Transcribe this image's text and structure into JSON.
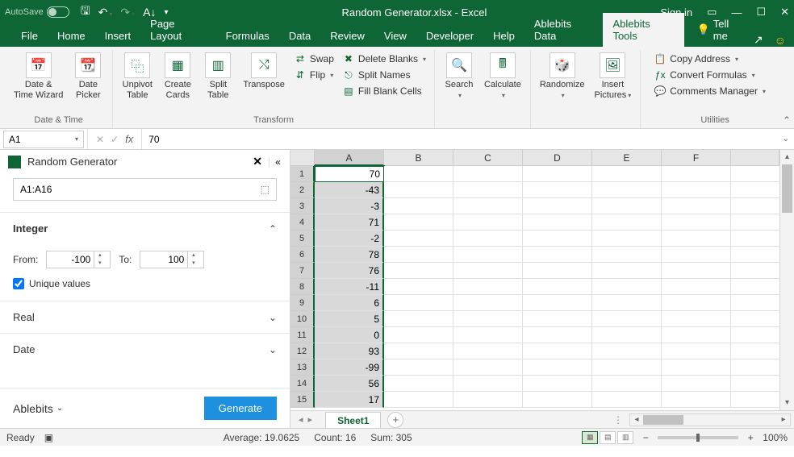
{
  "title_bar": {
    "autosave_label": "AutoSave",
    "autosave_state": "Off",
    "doc_title": "Random Generator.xlsx - Excel",
    "signin": "Sign in"
  },
  "ribbon_tabs": {
    "file": "File",
    "items": [
      "Home",
      "Insert",
      "Page Layout",
      "Formulas",
      "Data",
      "Review",
      "View",
      "Developer",
      "Help",
      "Ablebits Data",
      "Ablebits Tools"
    ],
    "active": "Ablebits Tools",
    "tellme": "Tell me"
  },
  "ribbon": {
    "group_datetime": {
      "label": "Date & Time",
      "btn_wizard": "Date &\nTime Wizard",
      "btn_datepicker": "Date\nPicker"
    },
    "group_transform": {
      "label": "Transform",
      "btn_unpivot": "Unpivot\nTable",
      "btn_createcards": "Create\nCards",
      "btn_splittable": "Split\nTable",
      "btn_transpose": "Transpose",
      "swap": "Swap",
      "flip": "Flip",
      "deleteblanks": "Delete Blanks",
      "splitnames": "Split Names",
      "fillblank": "Fill Blank Cells"
    },
    "group_mid": {
      "search": "Search",
      "calculate": "Calculate",
      "randomize": "Randomize",
      "insertpics": "Insert\nPictures"
    },
    "group_utilities": {
      "label": "Utilities",
      "copyaddr": "Copy Address",
      "convertf": "Convert Formulas",
      "comments": "Comments Manager"
    }
  },
  "formula_bar": {
    "name_box": "A1",
    "value": "70"
  },
  "task_pane": {
    "title": "Random Generator",
    "range": "A1:A16",
    "sections": {
      "integer": {
        "label": "Integer",
        "from_label": "From:",
        "from_value": "-100",
        "to_label": "To:",
        "to_value": "100",
        "unique_label": "Unique values",
        "unique_checked": true
      },
      "real": {
        "label": "Real"
      },
      "date": {
        "label": "Date"
      }
    },
    "brand": "Ablebits",
    "generate_btn": "Generate"
  },
  "grid": {
    "columns": [
      "A",
      "B",
      "C",
      "D",
      "E",
      "F"
    ],
    "selected_col": "A",
    "rows": [
      {
        "n": 1,
        "a": "70"
      },
      {
        "n": 2,
        "a": "-43"
      },
      {
        "n": 3,
        "a": "-3"
      },
      {
        "n": 4,
        "a": "71"
      },
      {
        "n": 5,
        "a": "-2"
      },
      {
        "n": 6,
        "a": "78"
      },
      {
        "n": 7,
        "a": "76"
      },
      {
        "n": 8,
        "a": "-11"
      },
      {
        "n": 9,
        "a": "6"
      },
      {
        "n": 10,
        "a": "5"
      },
      {
        "n": 11,
        "a": "0"
      },
      {
        "n": 12,
        "a": "93"
      },
      {
        "n": 13,
        "a": "-99"
      },
      {
        "n": 14,
        "a": "56"
      },
      {
        "n": 15,
        "a": "17"
      }
    ]
  },
  "sheet_bar": {
    "active_sheet": "Sheet1"
  },
  "status_bar": {
    "ready": "Ready",
    "average": "Average: 19.0625",
    "count": "Count: 16",
    "sum": "Sum: 305",
    "zoom": "100%"
  }
}
